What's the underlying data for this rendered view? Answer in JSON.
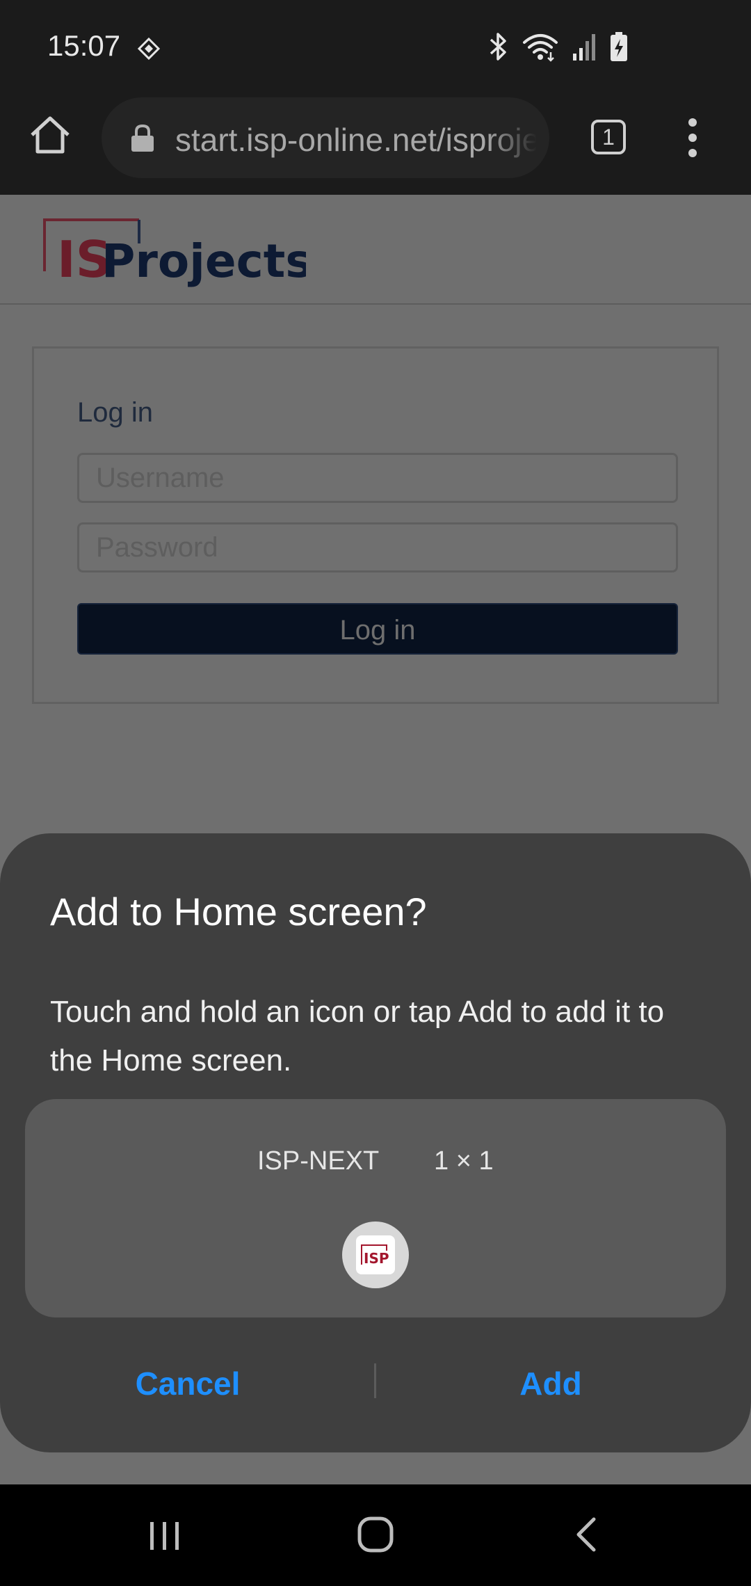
{
  "status_bar": {
    "time": "15:07"
  },
  "toolbar": {
    "url": "start.isp-online.net/isprojects",
    "tab_count": "1"
  },
  "page": {
    "logo": {
      "part1": "IS",
      "part2": "Projects"
    },
    "login": {
      "title": "Log in",
      "username_placeholder": "Username",
      "password_placeholder": "Password",
      "button_label": "Log in"
    }
  },
  "dialog": {
    "title": "Add to Home screen?",
    "body": "Touch and hold an icon or tap Add to add it to the Home screen.",
    "app_name": "ISP-NEXT",
    "app_size": "1 × 1",
    "icon_text": "ISP",
    "cancel_label": "Cancel",
    "add_label": "Add"
  },
  "colors": {
    "accent": "#1e8fff",
    "dialog_bg": "#3f3f3f",
    "logo_red": "#a3162d",
    "logo_navy": "#0d1f44"
  }
}
